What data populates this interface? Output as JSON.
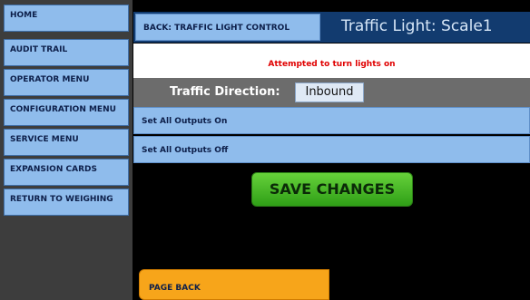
{
  "sidebar": {
    "items": [
      {
        "label": "HOME"
      },
      {
        "label": "AUDIT TRAIL"
      },
      {
        "label": "OPERATOR MENU"
      },
      {
        "label": "CONFIGURATION MENU"
      },
      {
        "label": "SERVICE MENU"
      },
      {
        "label": "EXPANSION CARDS"
      },
      {
        "label": "RETURN TO WEIGHING"
      }
    ]
  },
  "header": {
    "back_label": "BACK: TRAFFIC LIGHT CONTROL",
    "title": "Traffic Light: Scale1"
  },
  "status": {
    "message": "Attempted to turn lights on",
    "color": "#e00000"
  },
  "direction": {
    "label": "Traffic Direction:",
    "value": "Inbound"
  },
  "outputs": {
    "set_all_on": "Set All Outputs On",
    "set_all_off": "Set All Outputs Off"
  },
  "actions": {
    "save_label": "SAVE CHANGES",
    "page_back_label": "PAGE BACK"
  },
  "colors": {
    "button_blue": "#8fbcec",
    "header_navy": "#123b6f",
    "save_green": "#3cb526",
    "page_back_orange": "#f7a51a"
  }
}
